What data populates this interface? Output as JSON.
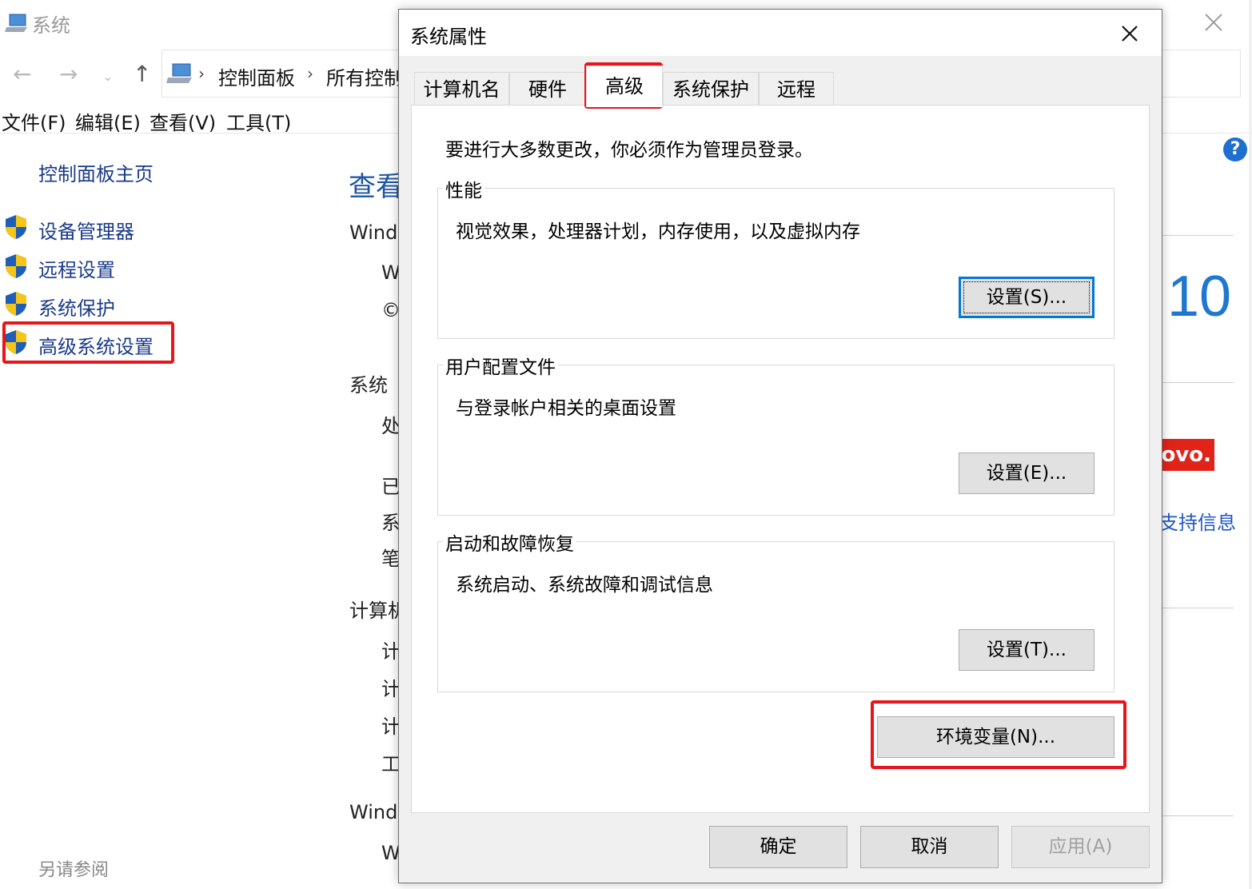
{
  "background_window": {
    "title": "系统",
    "address_crumbs": [
      "控制面板",
      "所有控制"
    ],
    "menu": [
      "文件(F)",
      "编辑(E)",
      "查看(V)",
      "工具(T)"
    ],
    "sidebar": {
      "home_link": "控制面板主页",
      "items": [
        {
          "label": "设备管理器",
          "icon": "uac-shield-icon"
        },
        {
          "label": "远程设置",
          "icon": "uac-shield-icon"
        },
        {
          "label": "系统保护",
          "icon": "uac-shield-icon"
        },
        {
          "label": "高级系统设置",
          "icon": "uac-shield-icon"
        }
      ],
      "see_also": "另请参阅"
    },
    "main": {
      "heading": "查看",
      "lines": [
        "Wind",
        "W",
        "©",
        "系统",
        "处",
        "已",
        "系",
        "笔",
        "计算机",
        "计",
        "计",
        "计",
        "工",
        "Wind",
        "W"
      ]
    },
    "right": {
      "version": "10",
      "brand": "novo.",
      "support_link": "支持信息",
      "help": "?"
    }
  },
  "dialog": {
    "title": "系统属性",
    "tabs": [
      "计算机名",
      "硬件",
      "高级",
      "系统保护",
      "远程"
    ],
    "active_tab": "高级",
    "notice": "要进行大多数更改，你必须作为管理员登录。",
    "groups": [
      {
        "legend": "性能",
        "description": "视觉效果，处理器计划，内存使用，以及虚拟内存",
        "button": "设置(S)..."
      },
      {
        "legend": "用户配置文件",
        "description": "与登录帐户相关的桌面设置",
        "button": "设置(E)..."
      },
      {
        "legend": "启动和故障恢复",
        "description": "系统启动、系统故障和调试信息",
        "button": "设置(T)..."
      }
    ],
    "env_button": "环境变量(N)...",
    "footer": {
      "ok": "确定",
      "cancel": "取消",
      "apply": "应用(A)"
    }
  },
  "colors": {
    "highlight": "#e8151b",
    "link": "#1a3a8a",
    "accent": "#0078d7"
  }
}
